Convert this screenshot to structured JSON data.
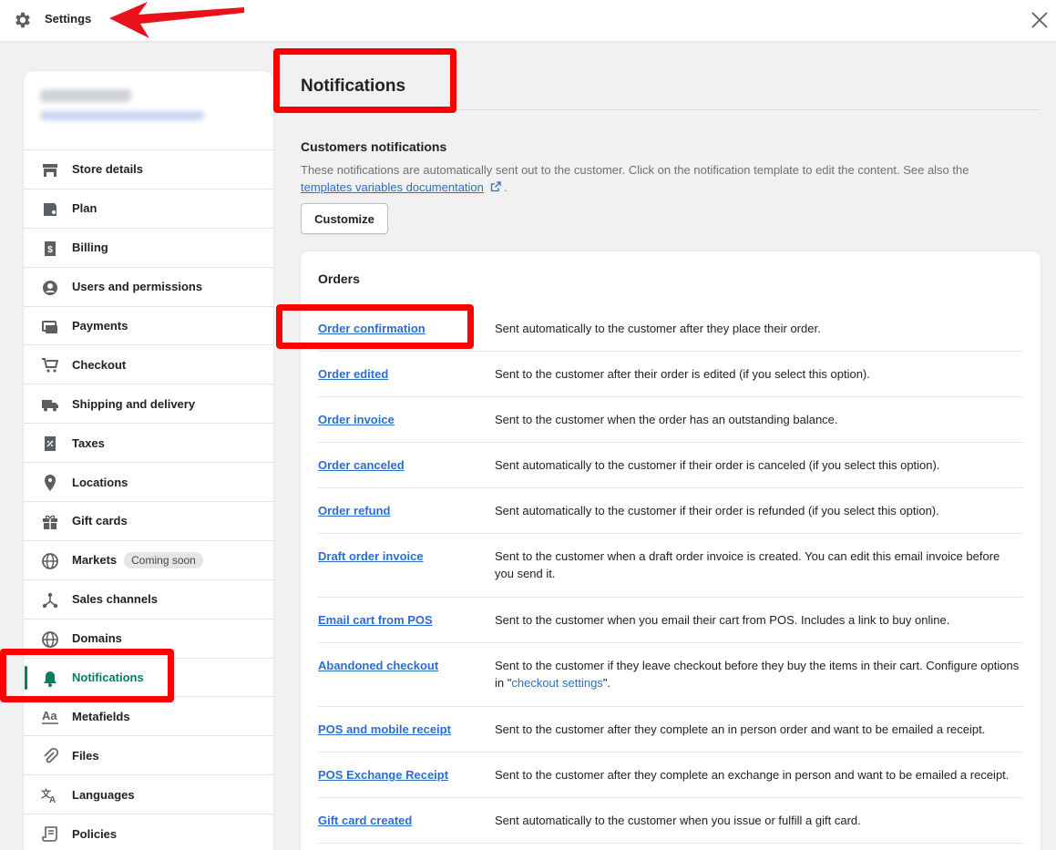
{
  "topbar": {
    "title": "Settings",
    "gear_icon": "gear-icon",
    "close_icon": "close-icon"
  },
  "sidebar": {
    "items": [
      {
        "label": "Store details",
        "icon": "store-icon"
      },
      {
        "label": "Plan",
        "icon": "plan-icon"
      },
      {
        "label": "Billing",
        "icon": "billing-icon"
      },
      {
        "label": "Users and permissions",
        "icon": "user-icon"
      },
      {
        "label": "Payments",
        "icon": "payments-icon"
      },
      {
        "label": "Checkout",
        "icon": "cart-icon"
      },
      {
        "label": "Shipping and delivery",
        "icon": "truck-icon"
      },
      {
        "label": "Taxes",
        "icon": "taxes-icon"
      },
      {
        "label": "Locations",
        "icon": "location-icon"
      },
      {
        "label": "Gift cards",
        "icon": "gift-icon"
      },
      {
        "label": "Markets",
        "icon": "globe-icon",
        "badge": "Coming soon"
      },
      {
        "label": "Sales channels",
        "icon": "channels-icon"
      },
      {
        "label": "Domains",
        "icon": "globe-icon"
      },
      {
        "label": "Notifications",
        "icon": "bell-icon",
        "active": true
      },
      {
        "label": "Metafields",
        "icon": "metafields-icon"
      },
      {
        "label": "Files",
        "icon": "paperclip-icon"
      },
      {
        "label": "Languages",
        "icon": "translate-icon"
      },
      {
        "label": "Policies",
        "icon": "policies-icon"
      }
    ]
  },
  "main": {
    "title": "Notifications",
    "section_title": "Customers notifications",
    "section_desc": "These notifications are automatically sent out to the customer. Click on the notification template to edit the content. See also the",
    "doc_link": "templates variables documentation",
    "doc_link_suffix": ".",
    "customize_label": "Customize",
    "orders": {
      "title": "Orders",
      "rows": [
        {
          "name": "Order confirmation",
          "desc": "Sent automatically to the customer after they place their order."
        },
        {
          "name": "Order edited",
          "desc": "Sent to the customer after their order is edited (if you select this option)."
        },
        {
          "name": "Order invoice",
          "desc": "Sent to the customer when the order has an outstanding balance."
        },
        {
          "name": "Order canceled",
          "desc": "Sent automatically to the customer if their order is canceled (if you select this option)."
        },
        {
          "name": "Order refund",
          "desc": "Sent automatically to the customer if their order is refunded (if you select this option)."
        },
        {
          "name": "Draft order invoice",
          "desc": "Sent to the customer when a draft order invoice is created. You can edit this email invoice before you send it."
        },
        {
          "name": "Email cart from POS",
          "desc": "Sent to the customer when you email their cart from POS. Includes a link to buy online."
        },
        {
          "name": "Abandoned checkout",
          "desc_prefix": "Sent to the customer if they leave checkout before they buy the items in their cart. Configure options in \"",
          "desc_link": "checkout settings",
          "desc_suffix": "\"."
        },
        {
          "name": "POS and mobile receipt",
          "desc": "Sent to the customer after they complete an in person order and want to be emailed a receipt."
        },
        {
          "name": "POS Exchange Receipt",
          "desc": "Sent to the customer after they complete an exchange in person and want to be emailed a receipt."
        },
        {
          "name": "Gift card created",
          "desc": "Sent automatically to the customer when you issue or fulfill a gift card."
        }
      ]
    }
  },
  "colors": {
    "accent_green": "#007f5f",
    "link_blue": "#2c6ecb",
    "highlight_red": "#ff0000"
  }
}
